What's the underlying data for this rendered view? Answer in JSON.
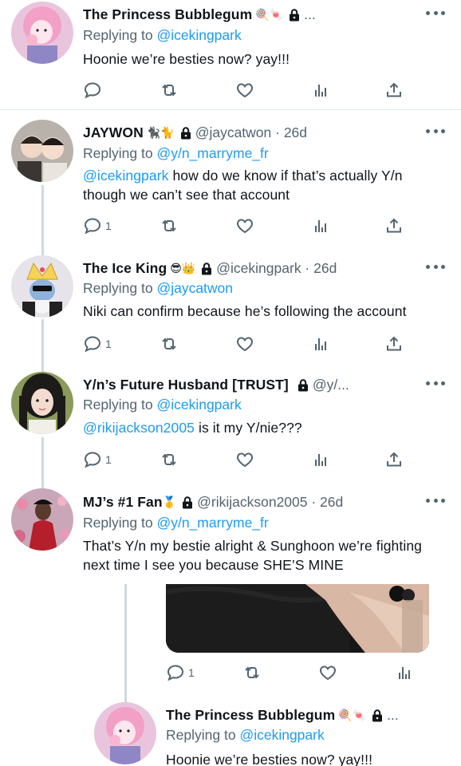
{
  "tweets": [
    {
      "name": "The Princess Bubblegum",
      "emoji": "🍭🍬",
      "handle": "...",
      "replying_label": "Replying to",
      "replying_to": "@icekingpark",
      "text_pre": "Hoonie we’re besties now? yay!!!",
      "mention": "",
      "text_post": "",
      "reply_count": ""
    },
    {
      "name": "JAYWON",
      "emoji": "🐈‍⬛🐈",
      "handle": "@jaycatwon · 26d",
      "replying_label": "Replying to",
      "replying_to": "@y/n_marryme_fr",
      "text_pre": "",
      "mention": "@icekingpark",
      "text_post": " how do we know if that’s actually Y/n though we can’t see that account",
      "reply_count": "1"
    },
    {
      "name": "The Ice King",
      "emoji": "😎👑",
      "handle": "@icekingpark · 26d",
      "replying_label": "Replying to",
      "replying_to": "@jaycatwon",
      "text_pre": "Niki can confirm because he’s following the account",
      "mention": "",
      "text_post": "",
      "reply_count": "1"
    },
    {
      "name": "Y/n’s Future Husband [TRUST]",
      "emoji": "",
      "handle": "@y/...",
      "replying_label": "Replying to",
      "replying_to": "@icekingpark",
      "text_pre": "",
      "mention": "@rikijackson2005",
      "text_post": " is it my Y/nie???",
      "reply_count": "1"
    },
    {
      "name": "MJ’s #1 Fan",
      "emoji": "🥇",
      "handle": "@rikijackson2005 · 26d",
      "replying_label": "Replying to",
      "replying_to": "@y/n_marryme_fr",
      "text_pre": "That’s Y/n my bestie alright & Sunghoon we’re fighting next time I see you because SHE’S MINE",
      "mention": "",
      "text_post": "",
      "reply_count": ""
    },
    {
      "name": "The Princess Bubblegum",
      "emoji": "🍭🍬",
      "handle": "...",
      "replying_label": "Replying to",
      "replying_to": "@icekingpark",
      "text_pre": "Hoonie we’re besties now? yay!!!",
      "mention": "",
      "text_post": "",
      "reply_count": ""
    }
  ],
  "quoted_actions": {
    "reply_count": "1"
  },
  "icons": {
    "reply": "reply-icon",
    "retweet": "retweet-icon",
    "like": "heart-icon",
    "views": "views-icon",
    "share": "share-icon",
    "more": "more-icon",
    "lock": "lock-icon"
  }
}
